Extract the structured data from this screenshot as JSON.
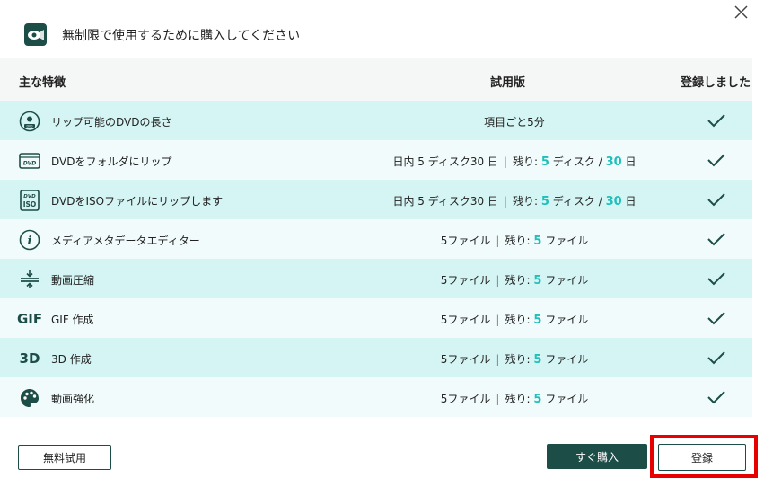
{
  "window": {
    "title": "無制限で使用するために購入してください",
    "app_icon": "app-logo-icon",
    "close_icon": "close-icon"
  },
  "table": {
    "headers": {
      "feature": "主な特徴",
      "trial": "試用版",
      "registered": "登録しました"
    },
    "rows": [
      {
        "icon": "dvd-disc-icon",
        "label": "リップ可能のDVDの長さ",
        "trial_plain": "項目ごと5分"
      },
      {
        "icon": "dvd-folder-icon",
        "label": "DVDをフォルダにリップ",
        "trial_prefix": "日内 5 ディスク30 日",
        "trial_remaining": "残り:",
        "trial_num1": "5",
        "trial_unit1": "ディスク /",
        "trial_num2": "30",
        "trial_unit2": "日"
      },
      {
        "icon": "dvd-iso-icon",
        "label": "DVDをISOファイルにリップします",
        "trial_prefix": "日内 5 ディスク30 日",
        "trial_remaining": "残り:",
        "trial_num1": "5",
        "trial_unit1": "ディスク /",
        "trial_num2": "30",
        "trial_unit2": "日"
      },
      {
        "icon": "info-icon",
        "label": "メディアメタデータエディター",
        "trial_prefix": "5ファイル",
        "trial_remaining": "残り:",
        "trial_num1": "5",
        "trial_unit1": "ファイル"
      },
      {
        "icon": "compress-icon",
        "label": "動画圧縮",
        "trial_prefix": "5ファイル",
        "trial_remaining": "残り:",
        "trial_num1": "5",
        "trial_unit1": "ファイル"
      },
      {
        "icon": "gif-icon",
        "icon_text": "GIF",
        "label": "GIF 作成",
        "trial_prefix": "5ファイル",
        "trial_remaining": "残り:",
        "trial_num1": "5",
        "trial_unit1": "ファイル"
      },
      {
        "icon": "3d-icon",
        "icon_text": "3D",
        "label": "3D 作成",
        "trial_prefix": "5ファイル",
        "trial_remaining": "残り:",
        "trial_num1": "5",
        "trial_unit1": "ファイル"
      },
      {
        "icon": "palette-icon",
        "label": "動画強化",
        "trial_prefix": "5ファイル",
        "trial_remaining": "残り:",
        "trial_num1": "5",
        "trial_unit1": "ファイル"
      }
    ],
    "check_icon": "checkmark-icon"
  },
  "footer": {
    "trial_button": "無料試用",
    "buy_button": "すぐ購入",
    "register_button": "登録"
  },
  "colors": {
    "brand": "#1d4d47",
    "accent": "#1fbfbb",
    "row_odd": "#d4f5f4",
    "row_even": "#f1fbfb",
    "highlight": "#e60000"
  }
}
